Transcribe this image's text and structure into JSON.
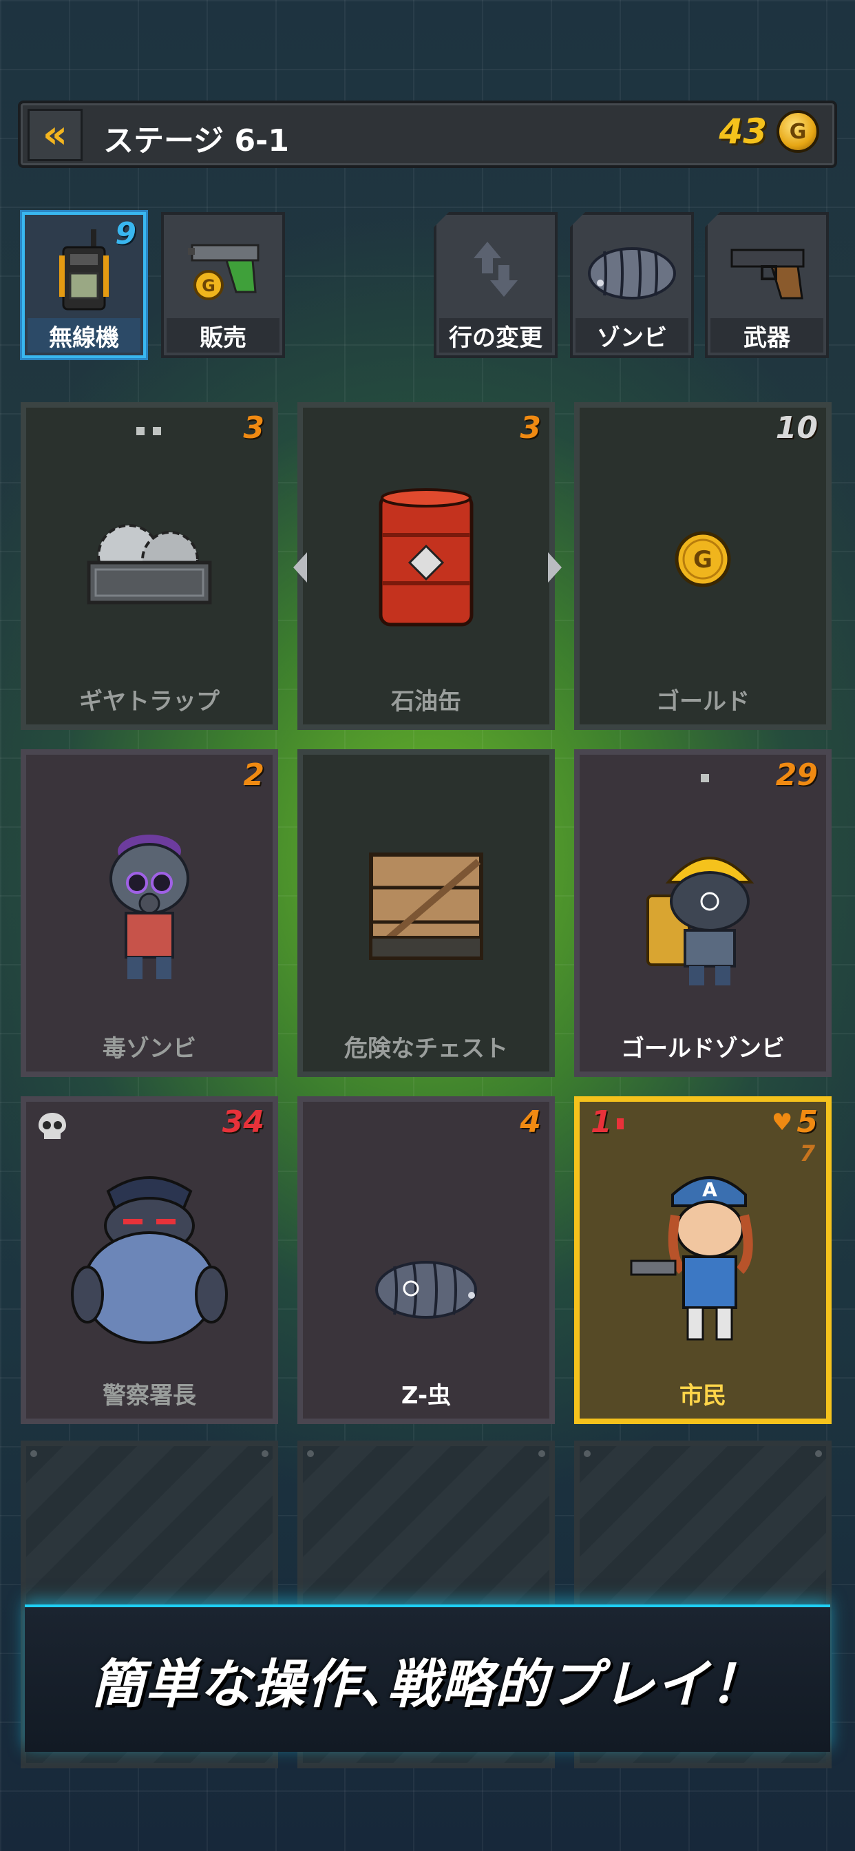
{
  "header": {
    "stage_title": "ステージ 6-1",
    "gold": "43",
    "back_icon": "double-chevron-left-icon",
    "coin_icon": "gold-coin-icon",
    "coin_letter": "G"
  },
  "toolbar": {
    "radio": {
      "label": "無線機",
      "count": "9"
    },
    "sell": {
      "label": "販売"
    },
    "swap_row": {
      "label": "行の変更"
    },
    "zombie": {
      "label": "ゾンビ"
    },
    "weapon": {
      "label": "武器"
    }
  },
  "cards": [
    {
      "name": "ギヤトラップ",
      "count": "3"
    },
    {
      "name": "石油缶",
      "count": "3"
    },
    {
      "name": "ゴールド",
      "count": "10"
    },
    {
      "name": "毒ゾンビ",
      "count": "2"
    },
    {
      "name": "危険なチェスト",
      "count": ""
    },
    {
      "name": "ゴールドゾンビ",
      "count": "29"
    },
    {
      "name": "警察署長",
      "count": "34"
    },
    {
      "name": "Z-虫",
      "count": "4"
    },
    {
      "name": "市民",
      "level": "1",
      "hp": "5",
      "sub": "7"
    }
  ],
  "banner": {
    "text": "簡単な操作､戦略的プレイ！"
  },
  "colors": {
    "accent_gold": "#f5c21c",
    "count_orange": "#f08a12",
    "active_blue": "#39b7f0",
    "danger_red": "#e8323a"
  }
}
